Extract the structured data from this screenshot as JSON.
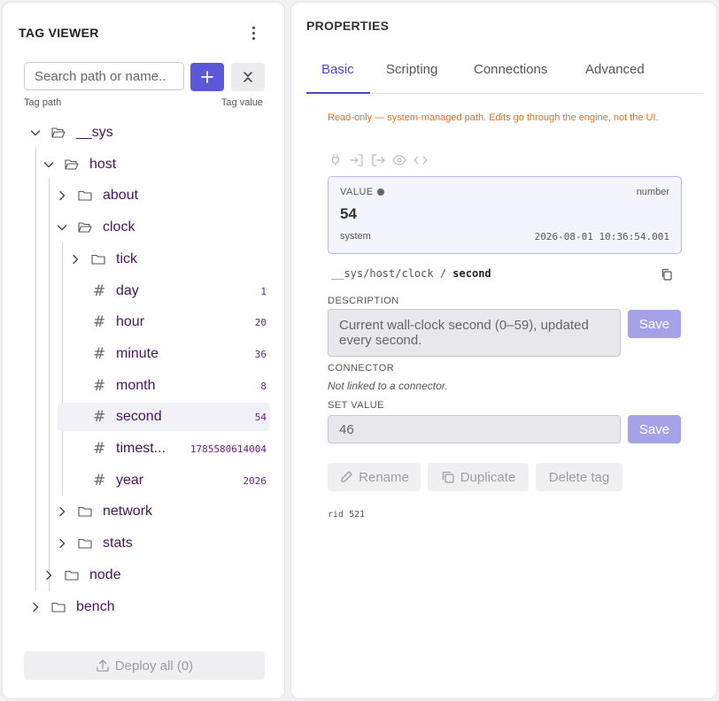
{
  "tag_viewer": {
    "title": "TAG VIEWER",
    "search_placeholder": "Search path or name..",
    "col_path": "Tag path",
    "col_value": "Tag value",
    "deploy_label": "Deploy all (0)"
  },
  "tree": [
    {
      "name": "__sys"
    },
    {
      "name": "host"
    },
    {
      "name": "about"
    },
    {
      "name": "clock"
    },
    {
      "name": "tick"
    },
    {
      "name": "day",
      "value": "1"
    },
    {
      "name": "hour",
      "value": "20"
    },
    {
      "name": "minute",
      "value": "36"
    },
    {
      "name": "month",
      "value": "8"
    },
    {
      "name": "second",
      "value": "54"
    },
    {
      "name": "timest...",
      "value": "1785580614004"
    },
    {
      "name": "year",
      "value": "2026"
    },
    {
      "name": "network"
    },
    {
      "name": "stats"
    },
    {
      "name": "node"
    },
    {
      "name": "bench"
    }
  ],
  "properties": {
    "title": "PROPERTIES",
    "tabs": [
      "Basic",
      "Scripting",
      "Connections",
      "Advanced"
    ],
    "warning": "Read-only — system-managed path. Edits go through the engine, not the UI.",
    "value_box": {
      "label": "VALUE",
      "type": "number",
      "value": "54",
      "source": "system",
      "timestamp": "2026-08-01 10:36:54.001"
    },
    "path_prefix": "__sys/host/clock",
    "path_sep": "/",
    "path_name": "second",
    "description_label": "DESCRIPTION",
    "description": "Current wall-clock second (0–59), updated every second.",
    "save_label": "Save",
    "connector_label": "CONNECTOR",
    "connector_text": "Not linked to a connector.",
    "set_value_label": "SET VALUE",
    "set_value": "46",
    "rename_label": "Rename",
    "duplicate_label": "Duplicate",
    "delete_label": "Delete tag",
    "rid": "rid 521"
  },
  "colors": {
    "accent": "#5b57d6",
    "tag_name": "#4a1262",
    "warning": "#e8701c"
  }
}
